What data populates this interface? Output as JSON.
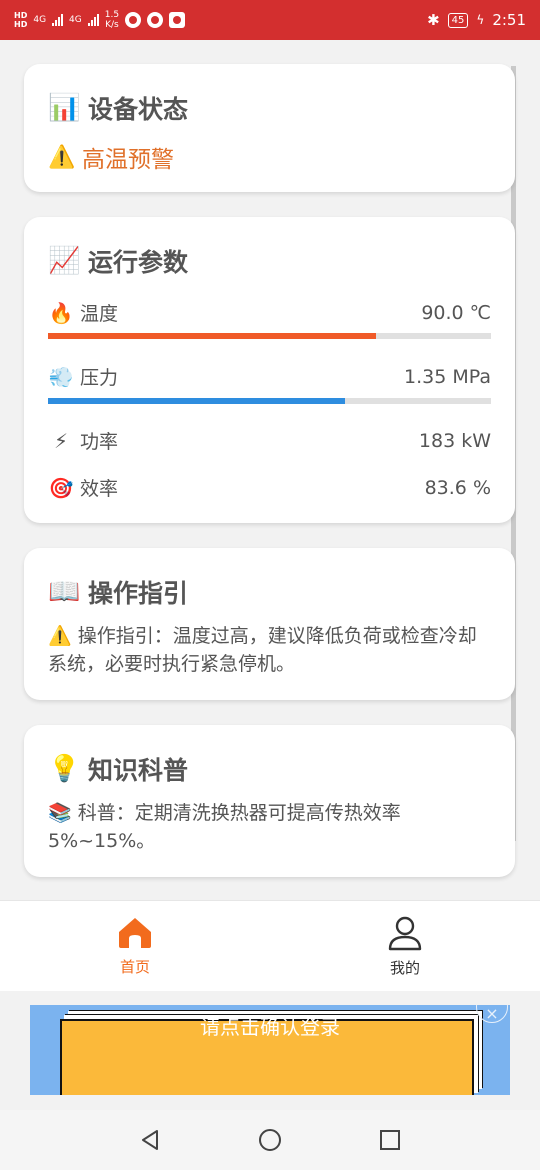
{
  "status_bar": {
    "hd1": "HD",
    "hd2": "HD",
    "net1": "4G",
    "net2": "4G",
    "speed_value": "1.5",
    "speed_unit": "K/s",
    "battery": "45",
    "time": "2:51"
  },
  "cards": {
    "device_status": {
      "title": "设备状态",
      "title_icon": "📊",
      "warning_icon": "⚠️",
      "warning_text": "高温预警"
    },
    "params": {
      "title": "运行参数",
      "title_icon": "📈",
      "temperature": {
        "icon": "🔥",
        "label": "温度",
        "value": "90.0 ℃",
        "fill_fraction": 0.74,
        "color": "#f05a28"
      },
      "pressure": {
        "icon": "💨",
        "label": "压力",
        "value": "1.35 MPa",
        "fill_fraction": 0.67,
        "color": "#2e8ddf"
      },
      "power": {
        "icon": "⚡",
        "label": "功率",
        "value": "183 kW"
      },
      "efficiency": {
        "icon": "🎯",
        "label": "效率",
        "value": "83.6 %"
      }
    },
    "guide": {
      "title": "操作指引",
      "title_icon": "📖",
      "text": "⚠️ 操作指引：温度过高，建议降低负荷或检查冷却系统，必要时执行紧急停机。"
    },
    "knowledge": {
      "title": "知识科普",
      "title_icon": "💡",
      "text": "📚 科普：定期清洗换热器可提高传热效率5%~15%。"
    }
  },
  "tabbar": {
    "home_label": "首页",
    "mine_label": "我的",
    "active_color": "#f26b1d"
  },
  "ad": {
    "text": "请点击确认登录",
    "close": "×"
  }
}
